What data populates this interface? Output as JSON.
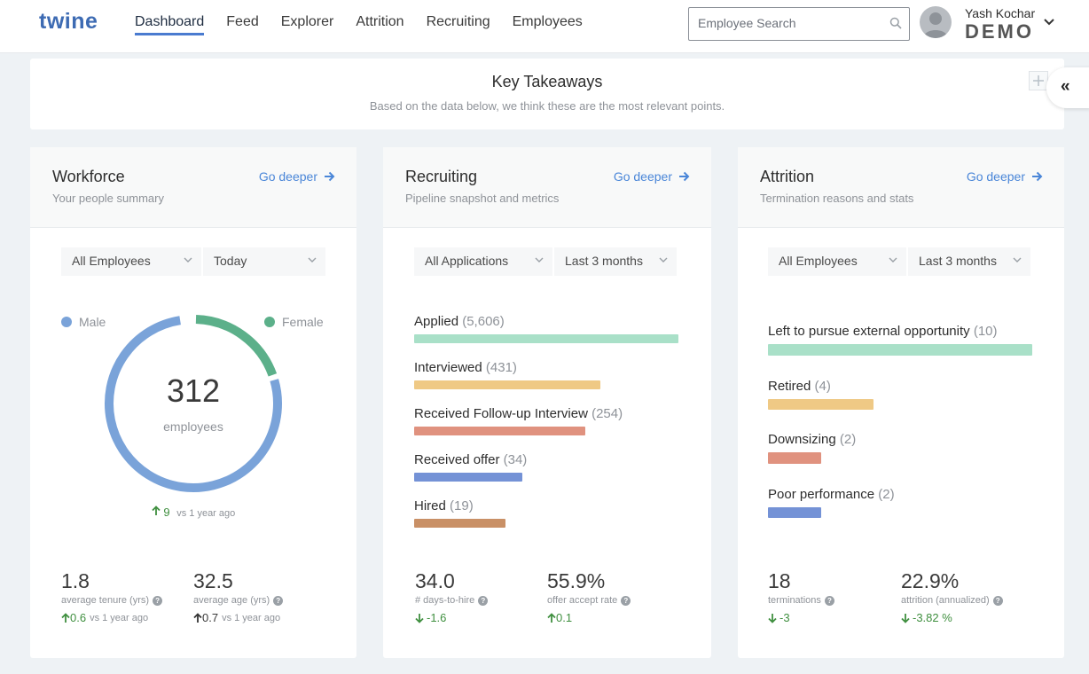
{
  "app": {
    "logo": "twine"
  },
  "nav": {
    "items": [
      {
        "label": "Dashboard"
      },
      {
        "label": "Feed"
      },
      {
        "label": "Explorer"
      },
      {
        "label": "Attrition"
      },
      {
        "label": "Recruiting"
      },
      {
        "label": "Employees"
      }
    ],
    "active": "Dashboard"
  },
  "search": {
    "placeholder": "Employee Search",
    "value": ""
  },
  "user": {
    "name": "Yash Kochar",
    "org": "DEMO"
  },
  "takeaways": {
    "title": "Key Takeaways",
    "subtitle": "Based on the data below, we think these are the most relevant points."
  },
  "colors": {
    "accent": "#4a86d8",
    "male": "#7aa3d9",
    "female": "#5cb08a",
    "positive": "#3f8f3f",
    "bar_green": "#a9e0c8",
    "bar_yellow": "#efc985",
    "bar_red": "#e0927f",
    "bar_blue": "#7492d6",
    "bar_brown": "#c99066"
  },
  "workforce": {
    "title": "Workforce",
    "subtitle": "Your people summary",
    "go_deeper": "Go deeper",
    "filter_1": "All Employees",
    "filter_2": "Today",
    "legend_male": "Male",
    "legend_female": "Female",
    "total": "312",
    "total_label": "employees",
    "change": "9",
    "change_vs": "vs 1 year ago",
    "female_share": 0.2,
    "stats": [
      {
        "value": "1.8",
        "label": "average tenure (yrs)",
        "delta": "0.6",
        "vs": "vs 1 year ago"
      },
      {
        "value": "32.5",
        "label": "average age (yrs)",
        "delta": "0.7",
        "vs": "vs 1 year ago"
      }
    ]
  },
  "recruiting": {
    "title": "Recruiting",
    "subtitle": "Pipeline snapshot and metrics",
    "go_deeper": "Go deeper",
    "filter_1": "All Applications",
    "filter_2": "Last 3 months",
    "stages": [
      {
        "label": "Applied",
        "count": "(5,606)",
        "share": 1.0
      },
      {
        "label": "Interviewed",
        "count": "(431)",
        "share": 0.705
      },
      {
        "label": "Received Follow-up Interview",
        "count": "(254)",
        "share": 0.648
      },
      {
        "label": "Received offer",
        "count": "(34)",
        "share": 0.41
      },
      {
        "label": "Hired",
        "count": "(19)",
        "share": 0.345
      }
    ],
    "stats": [
      {
        "value": "34.0",
        "label": "# days-to-hire",
        "delta": "-1.6"
      },
      {
        "value": "55.9%",
        "label": "offer accept rate",
        "delta": "0.1"
      }
    ]
  },
  "attrition": {
    "title": "Attrition",
    "subtitle": "Termination reasons and stats",
    "go_deeper": "Go deeper",
    "filter_1": "All Employees",
    "filter_2": "Last 3 months",
    "reasons": [
      {
        "label": "Left to pursue external opportunity",
        "count": "(10)",
        "share": 1.0
      },
      {
        "label": "Retired",
        "count": "(4)",
        "share": 0.4
      },
      {
        "label": "Downsizing",
        "count": "(2)",
        "share": 0.2
      },
      {
        "label": "Poor performance",
        "count": "(2)",
        "share": 0.2
      }
    ],
    "stats": [
      {
        "value": "18",
        "label": "terminations",
        "delta": "-3"
      },
      {
        "value": "22.9%",
        "label": "attrition (annualized)",
        "delta": "-3.82 %"
      }
    ]
  }
}
